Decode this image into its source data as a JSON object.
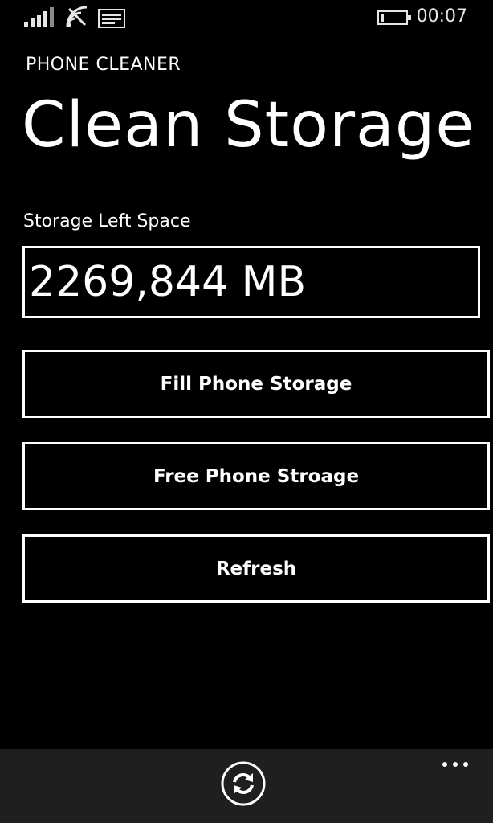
{
  "status_bar": {
    "time": "00:07",
    "icons": [
      "signal-icon",
      "wifi-icon",
      "message-icon",
      "battery-icon"
    ]
  },
  "app": {
    "title": "PHONE CLEANER",
    "page_title": "Clean Storage"
  },
  "storage": {
    "label": "Storage Left Space",
    "value": "2269,844 MB"
  },
  "buttons": {
    "fill": "Fill Phone Storage",
    "free": "Free Phone Stroage",
    "refresh": "Refresh"
  },
  "app_bar": {
    "icons": [
      "sync-icon",
      "more-icon"
    ]
  },
  "colors": {
    "background": "#000000",
    "foreground": "#ffffff",
    "app_bar": "#1f1f1f"
  }
}
